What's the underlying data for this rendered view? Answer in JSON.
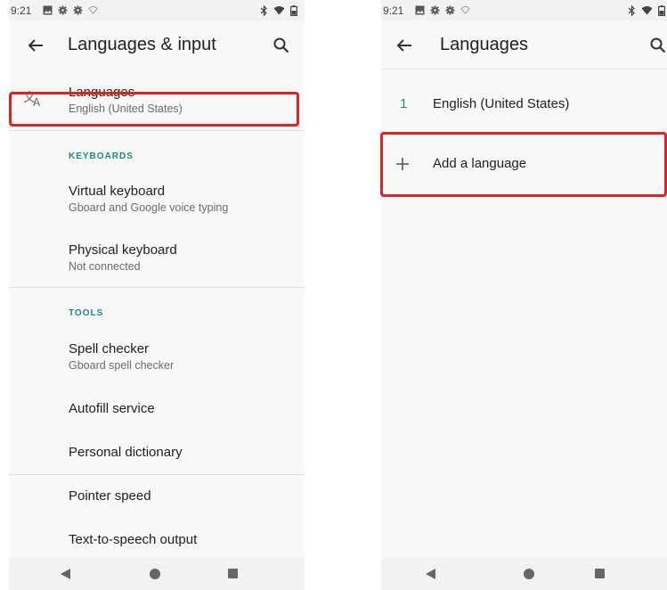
{
  "left_screen": {
    "status": {
      "time": "9:21"
    },
    "app_bar": {
      "title": "Languages & input"
    },
    "languages": {
      "title": "Languages",
      "subtitle": "English (United States)"
    },
    "keyboards_section": {
      "header": "KEYBOARDS"
    },
    "virtual_keyboard": {
      "title": "Virtual keyboard",
      "subtitle": "Gboard and Google voice typing"
    },
    "physical_keyboard": {
      "title": "Physical keyboard",
      "subtitle": "Not connected"
    },
    "tools_section": {
      "header": "TOOLS"
    },
    "spell_checker": {
      "title": "Spell checker",
      "subtitle": "Gboard spell checker"
    },
    "autofill": {
      "title": "Autofill service"
    },
    "dictionary": {
      "title": "Personal dictionary"
    },
    "pointer_speed": {
      "title": "Pointer speed"
    },
    "tts": {
      "title": "Text-to-speech output"
    }
  },
  "right_screen": {
    "status": {
      "time": "9:21"
    },
    "app_bar": {
      "title": "Languages"
    },
    "language_list": [
      {
        "index": "1",
        "name": "English (United States)"
      }
    ],
    "add_language": {
      "label": "Add a language"
    }
  },
  "colors": {
    "accent": "#1a8a7f",
    "highlight": "#e02222",
    "background": "#f8f8f8"
  }
}
